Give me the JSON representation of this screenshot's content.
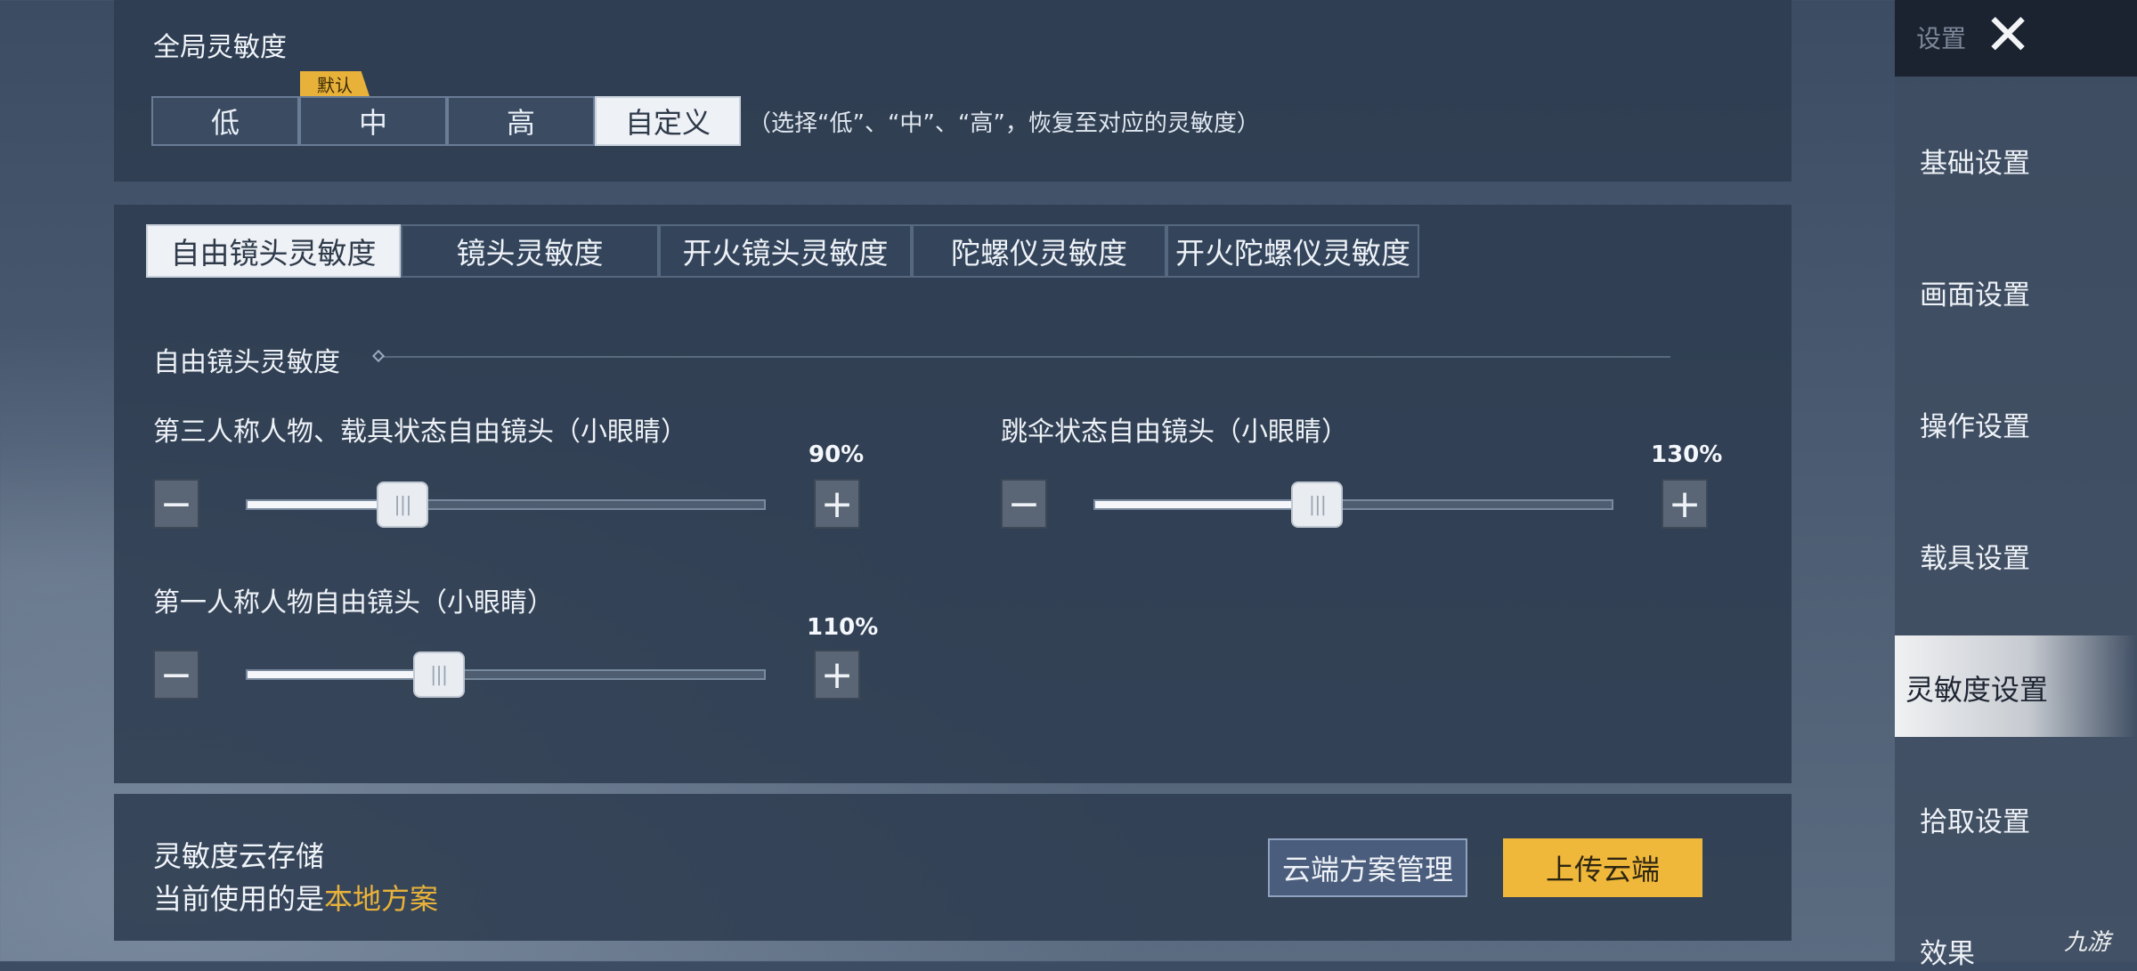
{
  "global": {
    "title": "全局灵敏度",
    "presets": [
      "低",
      "中",
      "高",
      "自定义"
    ],
    "active_preset": "自定义",
    "default_badge": "默认",
    "hint": "（选择“低”、“中”、“高”，恢复至对应的灵敏度）"
  },
  "tabs": [
    "自由镜头灵敏度",
    "镜头灵敏度",
    "开火镜头灵敏度",
    "陀螺仪灵敏度",
    "开火陀螺仪灵敏度"
  ],
  "active_tab": "自由镜头灵敏度",
  "section_title": "自由镜头灵敏度",
  "sliders": [
    {
      "label": "第三人称人物、载具状态自由镜头（小眼睛）",
      "value_text": "90%",
      "fraction": 0.3
    },
    {
      "label": "跳伞状态自由镜头（小眼睛）",
      "value_text": "130%",
      "fraction": 0.43
    },
    {
      "label": "第一人称人物自由镜头（小眼睛）",
      "value_text": "110%",
      "fraction": 0.37
    }
  ],
  "stepper": {
    "minus": "−",
    "plus": "+",
    "thumb_grip": "|||"
  },
  "cloud": {
    "title": "灵敏度云存储",
    "current_prefix": "当前使用的是",
    "current_scheme": "本地方案",
    "manage_button": "云端方案管理",
    "upload_button": "上传云端"
  },
  "sidebar": {
    "header": "设置",
    "close": "✕",
    "items": [
      "基础设置",
      "画面设置",
      "操作设置",
      "载具设置",
      "灵敏度设置",
      "拾取设置",
      "效果"
    ],
    "active_item": "灵敏度设置"
  },
  "watermark": "九游"
}
